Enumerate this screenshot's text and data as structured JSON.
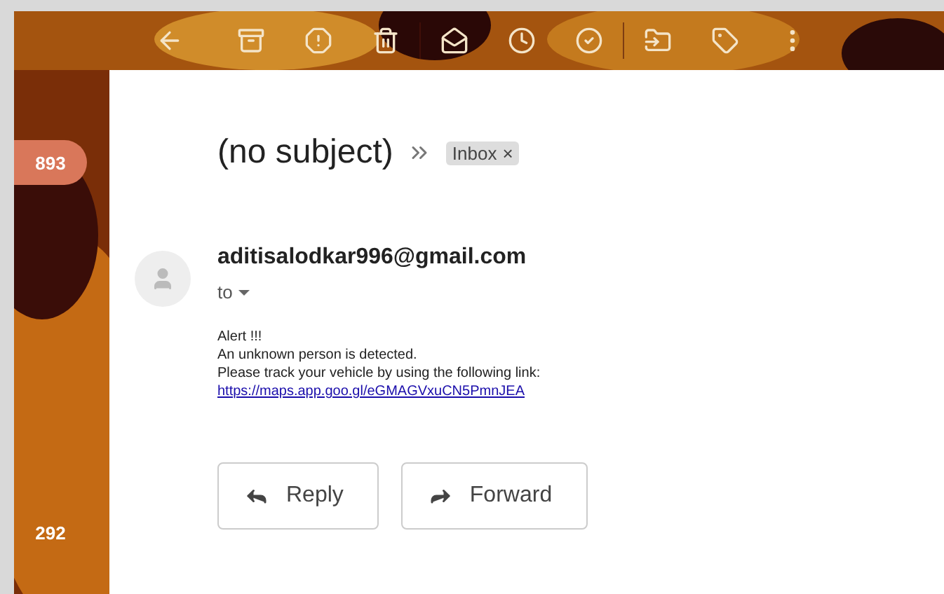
{
  "sidebar": {
    "items": [
      {
        "count": "893",
        "selected": true
      },
      {
        "count": "292",
        "selected": false
      }
    ]
  },
  "email": {
    "subject": "(no subject)",
    "label": {
      "text": "Inbox",
      "close": "×"
    },
    "sender": "aditisalodkar996@gmail.com",
    "recipient": "to",
    "body": [
      "Alert !!!",
      "An unknown person is detected.",
      "Please track your vehicle by using the following link:"
    ],
    "link": "https://maps.app.goo.gl/eGMAGVxuCN5PmnJEA"
  },
  "buttons": [
    {
      "kind": "reply",
      "label": "Reply"
    },
    {
      "kind": "forward",
      "label": "Forward"
    }
  ]
}
